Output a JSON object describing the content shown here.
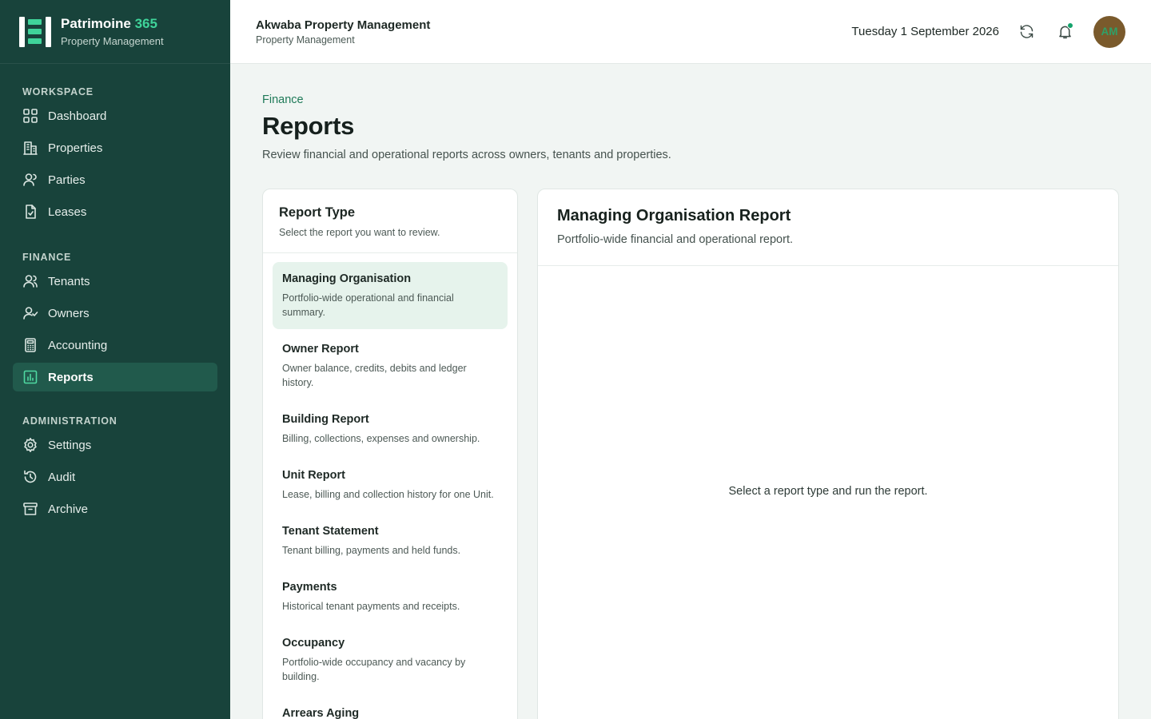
{
  "brand": {
    "name_main": "Patrimoine",
    "name_accent": "365",
    "subtitle": "Property Management"
  },
  "sidebar": {
    "sections": [
      {
        "title": "WORKSPACE",
        "items": [
          {
            "label": "Dashboard",
            "icon": "grid-icon"
          },
          {
            "label": "Properties",
            "icon": "building-icon"
          },
          {
            "label": "Parties",
            "icon": "users-icon"
          },
          {
            "label": "Leases",
            "icon": "document-check-icon"
          }
        ]
      },
      {
        "title": "FINANCE",
        "items": [
          {
            "label": "Tenants",
            "icon": "users-icon"
          },
          {
            "label": "Owners",
            "icon": "user-check-icon"
          },
          {
            "label": "Accounting",
            "icon": "calculator-icon"
          },
          {
            "label": "Reports",
            "icon": "bar-chart-icon",
            "active": true
          }
        ]
      },
      {
        "title": "ADMINISTRATION",
        "items": [
          {
            "label": "Settings",
            "icon": "gear-icon"
          },
          {
            "label": "Audit",
            "icon": "history-icon"
          },
          {
            "label": "Archive",
            "icon": "archive-icon"
          }
        ]
      }
    ]
  },
  "header": {
    "org_name": "Akwaba Property Management",
    "org_subtitle": "Property Management",
    "date": "Tuesday 1 September 2026",
    "avatar_initials": "AM"
  },
  "page": {
    "breadcrumb": "Finance",
    "title": "Reports",
    "description": "Review financial and operational reports across owners, tenants and properties."
  },
  "report_type": {
    "title": "Report Type",
    "subtitle": "Select the report you want to review.",
    "items": [
      {
        "title": "Managing Organisation",
        "desc": "Portfolio-wide operational and financial summary.",
        "selected": true
      },
      {
        "title": "Owner Report",
        "desc": "Owner balance, credits, debits and ledger history."
      },
      {
        "title": "Building Report",
        "desc": "Billing, collections, expenses and ownership."
      },
      {
        "title": "Unit Report",
        "desc": "Lease, billing and collection history for one Unit."
      },
      {
        "title": "Tenant Statement",
        "desc": "Tenant billing, payments and held funds."
      },
      {
        "title": "Payments",
        "desc": "Historical tenant payments and receipts."
      },
      {
        "title": "Occupancy",
        "desc": "Portfolio-wide occupancy and vacancy by building."
      },
      {
        "title": "Arrears Aging",
        "desc": ""
      }
    ]
  },
  "report_panel": {
    "title": "Managing Organisation Report",
    "subtitle": "Portfolio-wide financial and operational report.",
    "empty_message": "Select a report type and run the report."
  }
}
